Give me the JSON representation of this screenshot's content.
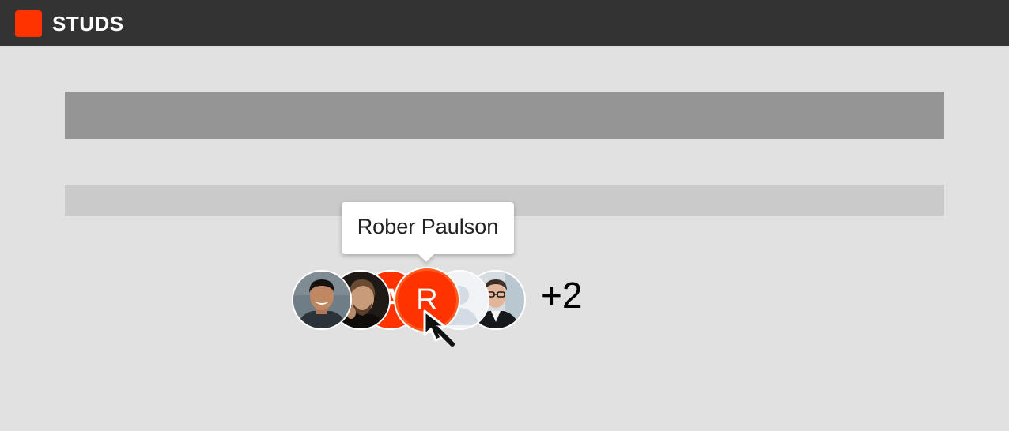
{
  "app": {
    "title": "STUDS",
    "brand_color": "#ff3300"
  },
  "tooltip": {
    "text": "Rober Paulson"
  },
  "avatar_group": {
    "avatars": [
      {
        "type": "photo",
        "icon": "person-photo-smiling-man"
      },
      {
        "type": "photo",
        "icon": "person-photo-bearded-man"
      },
      {
        "type": "initial",
        "initial": "A"
      },
      {
        "type": "initial",
        "initial": "R",
        "state": "hovered"
      },
      {
        "type": "placeholder",
        "icon": "user-silhouette-icon"
      },
      {
        "type": "photo",
        "icon": "person-photo-man-glasses"
      }
    ],
    "overflow_label": "+2"
  },
  "colors": {
    "header_bg": "#333333",
    "page_bg": "#e1e1e1",
    "accent": "#ff3300"
  }
}
